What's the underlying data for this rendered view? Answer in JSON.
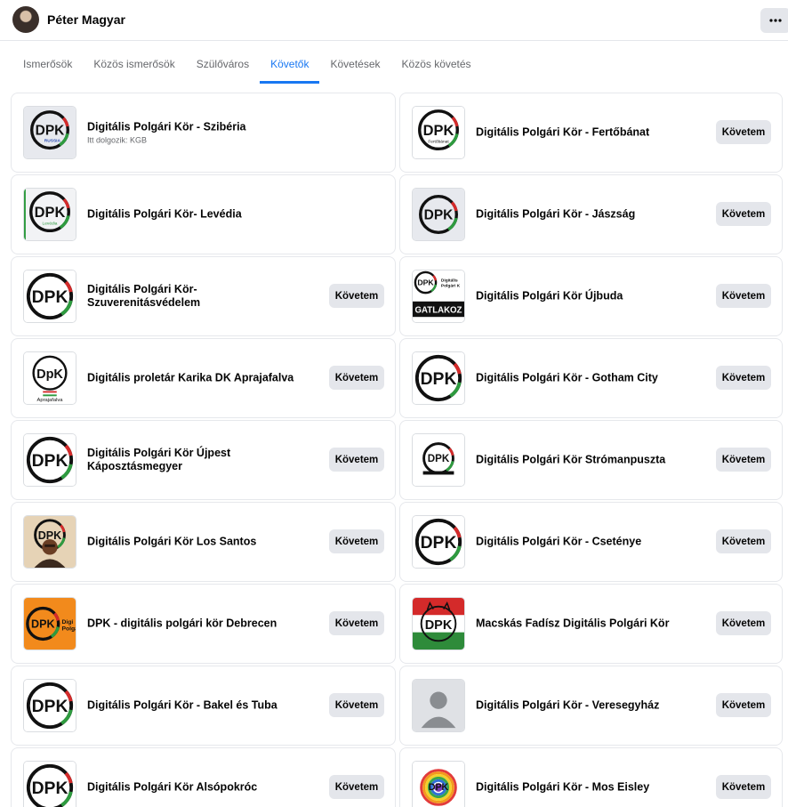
{
  "header": {
    "name": "Péter Magyar",
    "more_icon": "more-horizontal-icon"
  },
  "tabs": [
    {
      "label": "Ismerősök",
      "active": false
    },
    {
      "label": "Közös ismerősök",
      "active": false
    },
    {
      "label": "Szülőváros",
      "active": false
    },
    {
      "label": "Követők",
      "active": true
    },
    {
      "label": "Követések",
      "active": false
    },
    {
      "label": "Közös követés",
      "active": false
    }
  ],
  "follow_label": "Követem",
  "accent_color": "#1877f2",
  "followers": [
    {
      "name": "Digitális Polgári Kör - Szibéria",
      "subtitle": "Itt dolgozik: KGB",
      "thumb": "dpk-logo-siberia",
      "show_follow": false
    },
    {
      "name": "Digitális Polgári Kör - Fertőbánat",
      "subtitle": "",
      "thumb": "dpk-logo-fertobanat",
      "show_follow": true
    },
    {
      "name": "Digitális Polgári Kör- Levédia",
      "subtitle": "",
      "thumb": "dpk-logo-levedia",
      "show_follow": false
    },
    {
      "name": "Digitális Polgári Kör - Jászság",
      "subtitle": "",
      "thumb": "dpk-logo-gray",
      "show_follow": true
    },
    {
      "name": "Digitális Polgári Kör-Szuverenitásvédelem",
      "subtitle": "",
      "thumb": "dpk-logo",
      "show_follow": true
    },
    {
      "name": "Digitális Polgári Kör Újbuda",
      "subtitle": "",
      "thumb": "dpk-logo-ujbuda",
      "show_follow": true
    },
    {
      "name": "Digitális proletár Karika DK Aprajafalva",
      "subtitle": "",
      "thumb": "dpk-logo-aprajafalva",
      "show_follow": true
    },
    {
      "name": "Digitális Polgári Kör - Gotham City",
      "subtitle": "",
      "thumb": "dpk-logo",
      "show_follow": true
    },
    {
      "name": "Digitális Polgári Kör Újpest Káposztásmegyer",
      "subtitle": "",
      "thumb": "dpk-logo",
      "show_follow": true
    },
    {
      "name": "Digitális Polgári Kör Strómanpuszta",
      "subtitle": "",
      "thumb": "dpk-logo-small",
      "show_follow": true
    },
    {
      "name": "Digitális Polgári Kör Los Santos",
      "subtitle": "",
      "thumb": "dpk-logo-los-santos",
      "show_follow": true
    },
    {
      "name": "Digitális Polgári Kör - Csetényе",
      "subtitle": "",
      "thumb": "dpk-logo",
      "show_follow": true
    },
    {
      "name": "DPK - digitális polgári kör Debrecen",
      "subtitle": "",
      "thumb": "dpk-logo-orange",
      "show_follow": true
    },
    {
      "name": "Macskás Fadísz Digitális Polgári Kör",
      "subtitle": "",
      "thumb": "dpk-logo-flag",
      "show_follow": true
    },
    {
      "name": "Digitális Polgári Kör - Bakel és Tuba",
      "subtitle": "",
      "thumb": "dpk-logo",
      "show_follow": true
    },
    {
      "name": "Digitális Polgári Kör - Veresegyház",
      "subtitle": "",
      "thumb": "default-avatar-icon",
      "show_follow": true
    },
    {
      "name": "Digitális Polgári Kör Alsópokróc",
      "subtitle": "",
      "thumb": "dpk-logo",
      "show_follow": true
    },
    {
      "name": "Digitális Polgári Kör - Mos Eisley",
      "subtitle": "",
      "thumb": "dpk-logo-rainbow",
      "show_follow": true
    }
  ],
  "thumb_labels": {
    "siberia": "RUSSIA",
    "fertobanat": "Fertőbánat",
    "levedia": "Levédia",
    "aprajafalva": "Aprajafalva",
    "ujbuda_top": "Digitális Polgári K",
    "ujbuda_bottom": "GATLAKOZ",
    "debrecen": "Digi Polgá"
  }
}
